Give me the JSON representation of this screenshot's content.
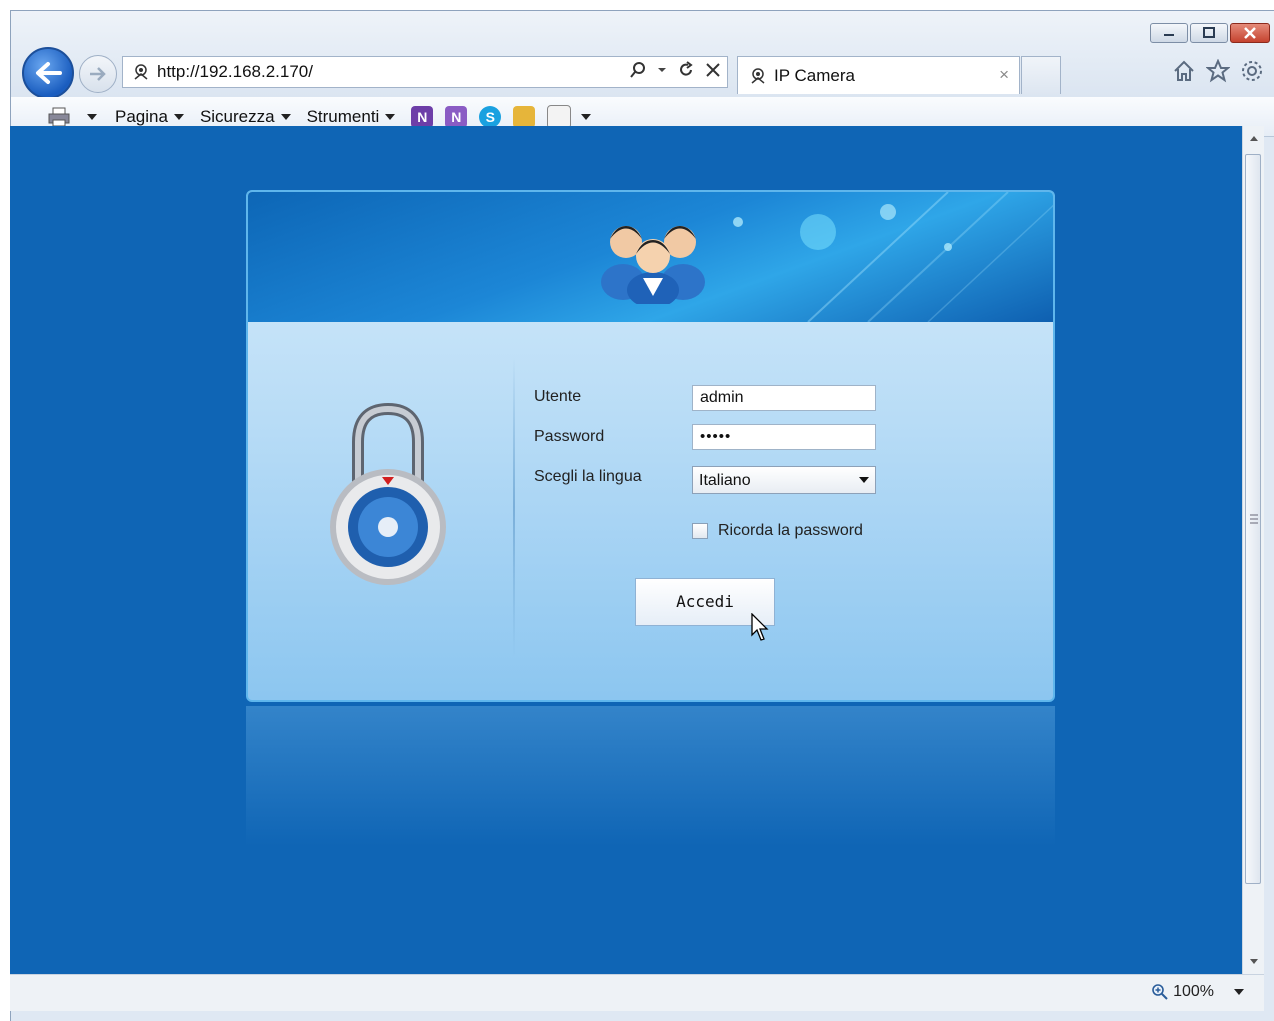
{
  "browser": {
    "url": "http://192.168.2.170/",
    "tab_title": "IP Camera",
    "tab_close": "×",
    "zoom": "100%"
  },
  "commandbar": {
    "pagina": "Pagina",
    "sicurezza": "Sicurezza",
    "strumenti": "Strumenti"
  },
  "login": {
    "user_label": "Utente",
    "user_value": "admin",
    "password_label": "Password",
    "password_value": "•••••",
    "language_label": "Scegli la lingua",
    "language_value": "Italiano",
    "remember_label": "Ricorda la password",
    "remember_checked": false,
    "submit_label": "Accedi"
  },
  "colors": {
    "page_background": "#0f65b5",
    "panel_header": "#0d66b6",
    "panel_body": "#b8dcf6"
  }
}
